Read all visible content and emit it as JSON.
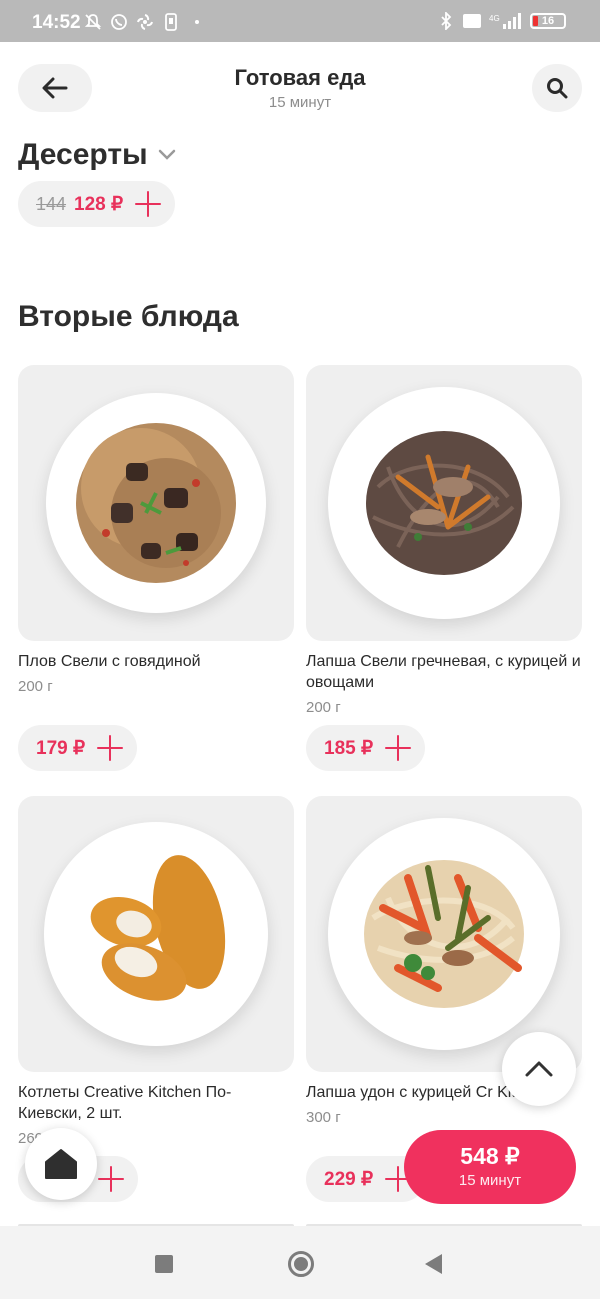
{
  "status_bar": {
    "time": "14:52",
    "battery": "16"
  },
  "header": {
    "title": "Готовая еда",
    "subtitle": "15 минут"
  },
  "sections": {
    "desserts": {
      "title": "Десерты",
      "item": {
        "old_price": "144",
        "price": "128 ₽"
      }
    },
    "mains": {
      "title": "Вторые блюда"
    }
  },
  "products": [
    {
      "name": "Плов Свели с говядиной",
      "weight": "200 г",
      "price": "179 ₽"
    },
    {
      "name": "Лапша Свели гречневая, с курицей и овощами",
      "weight": "200 г",
      "price": "185 ₽"
    },
    {
      "name": "Котлеты Creative Kitchen По-Киевски, 2 шт.",
      "weight": "260",
      "price": ""
    },
    {
      "name": "Лапша удон с курицей Cr Kitchen",
      "weight": "300 г",
      "price": "229 ₽"
    }
  ],
  "cart": {
    "total": "548 ₽",
    "time": "15 минут"
  },
  "colors": {
    "accent": "#e8315b",
    "cart_bg": "#f0315e",
    "pill_bg": "#f1f1f1"
  },
  "icons": {
    "back": "arrow-left-icon",
    "search": "search-icon",
    "chevron": "chevron-down-icon",
    "add": "plus-icon",
    "scroll_up": "chevron-up-icon",
    "home": "home-icon"
  }
}
